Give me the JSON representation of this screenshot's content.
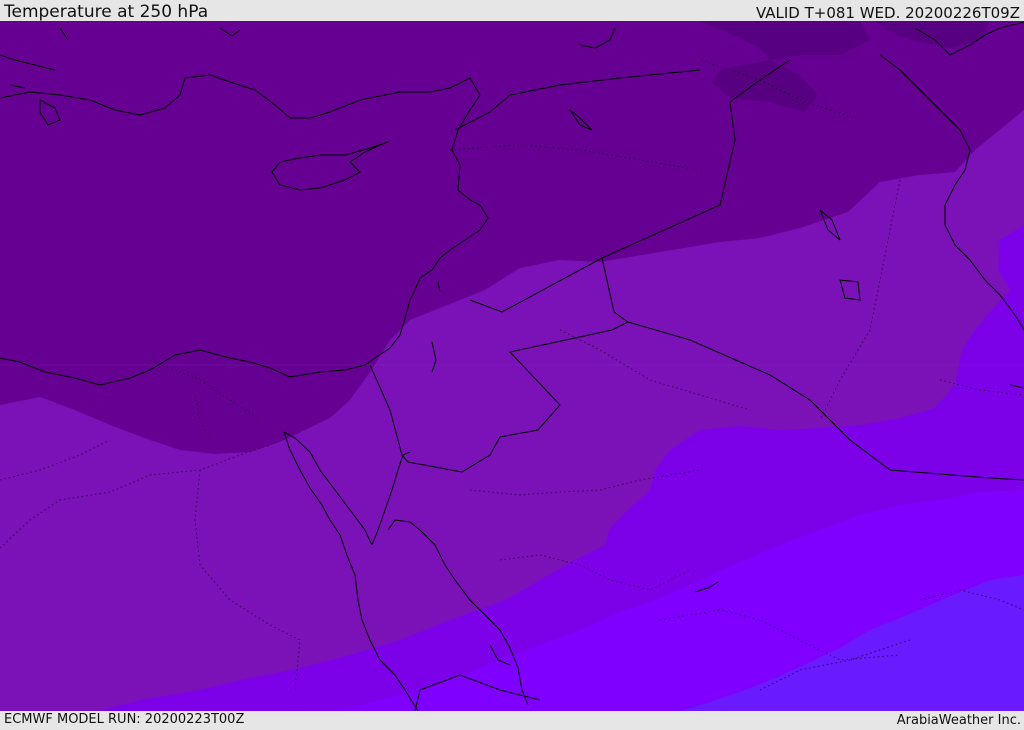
{
  "header": {
    "title": "Temperature at 250 hPa",
    "valid": "VALID T+081 WED. 20200226T09Z"
  },
  "footer": {
    "model_run": "ECMWF MODEL RUN: 20200223T00Z",
    "credit": "ArabiaWeather Inc."
  },
  "map": {
    "field": "temperature",
    "level": "250 hPa",
    "colors": {
      "band_darkest": "#55007f",
      "band_dark": "#650093",
      "band_mid": "#7a12b8",
      "band_light": "#7c00e8",
      "band_lighter": "#8000ff",
      "band_blue": "#6a1aff",
      "coastline": "#000000"
    }
  }
}
